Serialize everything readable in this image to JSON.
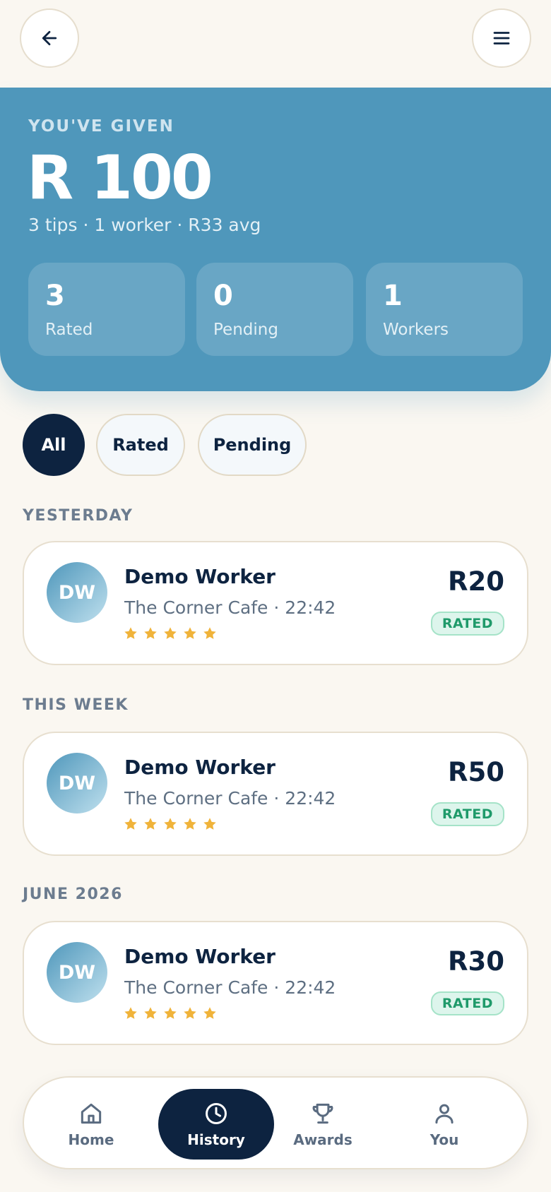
{
  "header": {
    "back_icon": "arrow-left-icon",
    "menu_icon": "hamburger-menu-icon"
  },
  "hero": {
    "eyebrow": "YOU'VE GIVEN",
    "total": "R 100",
    "summary": "3 tips · 1 worker · R33 avg",
    "stats": [
      {
        "value": "3",
        "label": "Rated"
      },
      {
        "value": "0",
        "label": "Pending"
      },
      {
        "value": "1",
        "label": "Workers"
      }
    ]
  },
  "filters": [
    {
      "label": "All",
      "active": true
    },
    {
      "label": "Rated",
      "active": false
    },
    {
      "label": "Pending",
      "active": false
    }
  ],
  "groups": [
    {
      "label": "YESTERDAY",
      "tip": {
        "initials": "DW",
        "name": "Demo Worker",
        "meta": "The Corner Cafe · 22:42",
        "stars": 5,
        "amount": "R20",
        "status": "RATED"
      }
    },
    {
      "label": "THIS WEEK",
      "tip": {
        "initials": "DW",
        "name": "Demo Worker",
        "meta": "The Corner Cafe · 22:42",
        "stars": 5,
        "amount": "R50",
        "status": "RATED"
      }
    },
    {
      "label": "JUNE 2026",
      "tip": {
        "initials": "DW",
        "name": "Demo Worker",
        "meta": "The Corner Cafe · 22:42",
        "stars": 5,
        "amount": "R30",
        "status": "RATED"
      }
    }
  ],
  "nav": [
    {
      "label": "Home",
      "icon": "home-icon",
      "active": false
    },
    {
      "label": "History",
      "icon": "clock-icon",
      "active": true
    },
    {
      "label": "Awards",
      "icon": "trophy-icon",
      "active": false
    },
    {
      "label": "You",
      "icon": "person-icon",
      "active": false
    }
  ],
  "colors": {
    "background": "#faf7f1",
    "hero": "#4f97bb",
    "navy": "#0d2340",
    "star": "#f0b33a",
    "rated_green": "#1f9a6a"
  }
}
